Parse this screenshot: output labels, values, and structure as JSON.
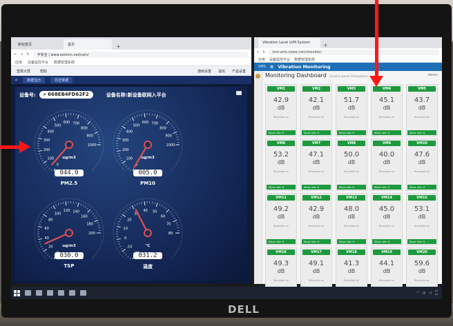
{
  "left_browser": {
    "tabs": [
      "新标签页",
      "首页"
    ],
    "address": "不安全 | www.semicn.net/com/",
    "bookmarks": [
      "应用",
      "设备监控平台",
      "数据管理系统"
    ],
    "app_menu": [
      "登录大屏",
      "帮助"
    ],
    "app_menu_right": [
      "通用设置",
      "退出",
      "产品设置"
    ],
    "nav_items": [
      "数据显示",
      "历史数据"
    ]
  },
  "dashboard": {
    "device_label": "设备号:",
    "device_id": "668EB4FD62F2",
    "device_name": "设备名称:新设备联网入平台",
    "gauges": [
      {
        "name": "PM2.5",
        "value": "044.0",
        "unit": "ug/m3",
        "ticks": [
          "0",
          "100",
          "200",
          "300",
          "400",
          "500",
          "600",
          "700",
          "800",
          "900",
          "1000"
        ],
        "reading": 44
      },
      {
        "name": "PM10",
        "value": "005.0",
        "unit": "ug/m3",
        "ticks": [
          "0",
          "100",
          "200",
          "300",
          "400",
          "500",
          "600",
          "700",
          "800",
          "900",
          "1000"
        ],
        "reading": 5
      },
      {
        "name": "TSP",
        "value": "030.0",
        "unit": "ug/m3",
        "ticks": [
          "0",
          "20",
          "40",
          "60",
          "80",
          "100",
          "120",
          "140",
          "160",
          "180",
          "200"
        ],
        "reading": 30
      },
      {
        "name": "温度",
        "value": "031.2",
        "unit": "℃",
        "ticks": [
          "-20",
          "-10",
          "0",
          "10",
          "20",
          "30",
          "40",
          "50",
          "60",
          "70",
          "80"
        ],
        "reading": 31.2
      }
    ]
  },
  "right_browser": {
    "tab": "Vibration Level LVM System",
    "address": "lvm-vms.noise.com/monitor/",
    "bookmarks": [
      "应用",
      "设备监控平台",
      "数据管理系统"
    ],
    "app_title": "Vibration Monitoring",
    "app_prefix": "VMS",
    "page_title": "Monitoring Dashboard",
    "page_sub": "Control panel  Exceptions",
    "header_right": "Admin",
    "more_info": "More info",
    "note": "Recorded on",
    "cards": [
      {
        "id": "VM1",
        "value": "42.9",
        "unit": "dB"
      },
      {
        "id": "VM2",
        "value": "42.1",
        "unit": "dB"
      },
      {
        "id": "VM3",
        "value": "51.7",
        "unit": "dB"
      },
      {
        "id": "VM4",
        "value": "45.1",
        "unit": "dB"
      },
      {
        "id": "VM5",
        "value": "43.7",
        "unit": "dB"
      },
      {
        "id": "VM6",
        "value": "53.2",
        "unit": "dB"
      },
      {
        "id": "VM7",
        "value": "47.1",
        "unit": "dB"
      },
      {
        "id": "VM8",
        "value": "50.0",
        "unit": "dB"
      },
      {
        "id": "VM9",
        "value": "40.0",
        "unit": "dB"
      },
      {
        "id": "VM10",
        "value": "47.6",
        "unit": "dB"
      },
      {
        "id": "VM11",
        "value": "49.2",
        "unit": "dB"
      },
      {
        "id": "VM12",
        "value": "42.9",
        "unit": "dB"
      },
      {
        "id": "VM13",
        "value": "48.0",
        "unit": "dB"
      },
      {
        "id": "VM14",
        "value": "45.0",
        "unit": "dB"
      },
      {
        "id": "VM15",
        "value": "53.1",
        "unit": "dB"
      },
      {
        "id": "VM16",
        "value": "49.3",
        "unit": "dB"
      },
      {
        "id": "VM17",
        "value": "49.1",
        "unit": "dB"
      },
      {
        "id": "VM18",
        "value": "41.3",
        "unit": "dB"
      },
      {
        "id": "VM19",
        "value": "44.1",
        "unit": "dB"
      },
      {
        "id": "VM20",
        "value": "59.6",
        "unit": "dB"
      }
    ]
  },
  "monitor_brand": "DELL",
  "colors": {
    "annotation_arrow": "#ff1717",
    "card_header": "#1e9a3e",
    "needle": "#e05050"
  }
}
